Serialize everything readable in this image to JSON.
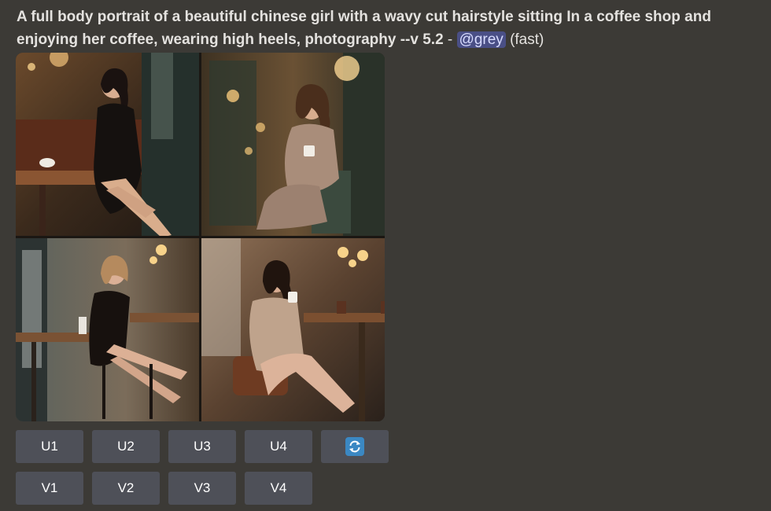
{
  "message": {
    "prompt_text": "A full body portrait of a beautiful chinese girl with a wavy cut hairstyle sitting In a coffee shop and enjoying her coffee, wearing high heels, photography --v 5.2",
    "separator": " - ",
    "mention": "@grey",
    "speed": " (fast)"
  },
  "image_grid": {
    "images": [
      {
        "description_icon": "image-1"
      },
      {
        "description_icon": "image-2"
      },
      {
        "description_icon": "image-3"
      },
      {
        "description_icon": "image-4"
      }
    ]
  },
  "buttons": {
    "upscale": [
      "U1",
      "U2",
      "U3",
      "U4"
    ],
    "variation": [
      "V1",
      "V2",
      "V3",
      "V4"
    ],
    "reroll_icon": "refresh-icon"
  },
  "colors": {
    "background": "#3c3a36",
    "button": "#4e5058",
    "mention_bg": "#4a4f86",
    "reroll_icon_bg": "#3b88c3"
  }
}
